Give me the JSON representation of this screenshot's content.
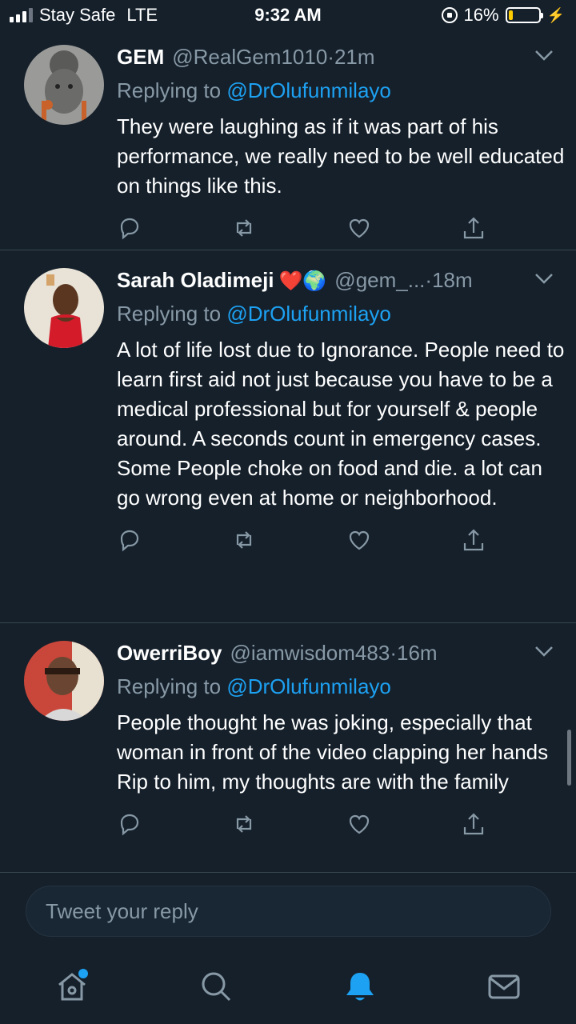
{
  "status_bar": {
    "carrier": "Stay Safe",
    "network": "LTE",
    "time": "9:32 AM",
    "battery": "16%",
    "battery_level": 0.16
  },
  "tweets": [
    {
      "name": "GEM",
      "handle": "@RealGem1010",
      "dot": "·",
      "time": "21m",
      "replying_prefix": "Replying to ",
      "replying_to": "@DrOlufunmilayo",
      "text": "They were laughing as if it was part of his performance, we really need to be well educated on things like this.",
      "emoji": ""
    },
    {
      "name": "Sarah Oladimeji",
      "emoji": "❤️🌍",
      "handle": "@gem_...",
      "dot": "·",
      "time": "18m",
      "replying_prefix": "Replying to ",
      "replying_to": "@DrOlufunmilayo",
      "text": "A lot of life lost due to Ignorance. People need to learn first aid not just because you have to be a medical professional but for yourself & people around. A seconds count in emergency cases. Some People choke on food and die. a lot can go wrong even at home or neighborhood."
    },
    {
      "name": "OwerriBoy",
      "handle": "@iamwisdom483",
      "dot": "·",
      "time": "16m",
      "replying_prefix": "Replying to ",
      "replying_to": "@DrOlufunmilayo",
      "text": "People thought he was joking, especially that woman in front of the video clapping her hands\nRip to him, my thoughts are with the family",
      "emoji": ""
    }
  ],
  "reply": {
    "placeholder": "Tweet your reply"
  },
  "tabs": [
    "home-icon",
    "search-icon",
    "notifications-icon",
    "messages-icon"
  ],
  "colors": {
    "background": "#15202b",
    "accent": "#1da1f2",
    "secondary_text": "#8899a6",
    "divider": "#38444d",
    "battery_fill": "#ffcc00"
  }
}
